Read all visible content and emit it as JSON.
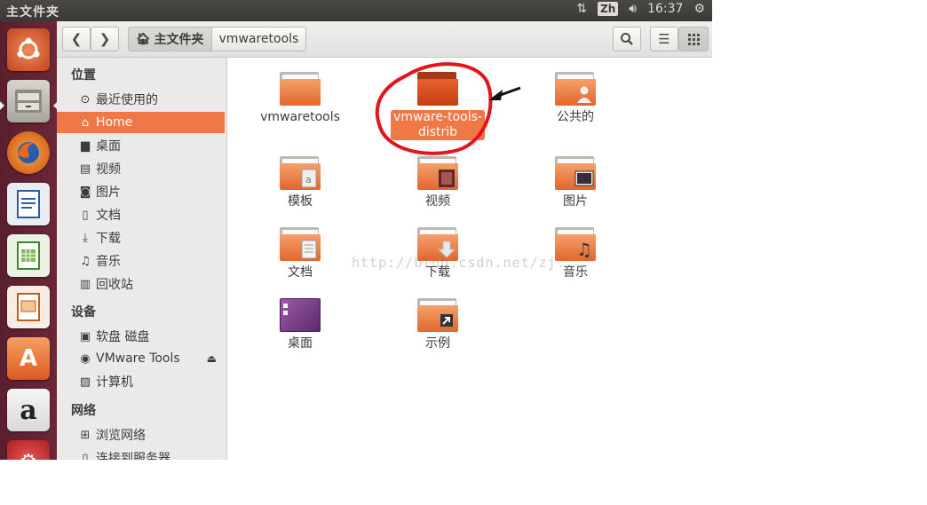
{
  "topbar": {
    "title": "主文件夹",
    "input_method": "Zh",
    "time": "16:37"
  },
  "launcher": {
    "items": [
      "ubuntu-dash",
      "files",
      "firefox",
      "writer",
      "calc",
      "impress",
      "software-center",
      "amazon",
      "settings"
    ]
  },
  "toolbar": {
    "crumb_home": "主文件夹",
    "crumb_current": "vmwaretools"
  },
  "sidebar": {
    "places_header": "位置",
    "places": [
      {
        "label": "最近使用的",
        "icon": "clock-icon"
      },
      {
        "label": "Home",
        "icon": "home-icon"
      },
      {
        "label": "桌面",
        "icon": "desktop-icon"
      },
      {
        "label": "视频",
        "icon": "film-icon"
      },
      {
        "label": "图片",
        "icon": "camera-icon"
      },
      {
        "label": "文档",
        "icon": "document-icon"
      },
      {
        "label": "下载",
        "icon": "download-icon"
      },
      {
        "label": "音乐",
        "icon": "music-icon"
      },
      {
        "label": "回收站",
        "icon": "trash-icon"
      }
    ],
    "devices_header": "设备",
    "devices": [
      {
        "label": "软盘 磁盘",
        "icon": "floppy-icon"
      },
      {
        "label": "VMware Tools",
        "icon": "cdrom-icon"
      },
      {
        "label": "计算机",
        "icon": "computer-icon"
      }
    ],
    "network_header": "网络",
    "network": [
      {
        "label": "浏览网络",
        "icon": "network-icon"
      },
      {
        "label": "连接到服务器",
        "icon": "server-icon"
      }
    ]
  },
  "files": [
    {
      "name": "vmwaretools",
      "emblem": "none"
    },
    {
      "name": "vmware-tools-distrib",
      "line1": "vmware-tools-",
      "line2": "distrib",
      "emblem": "none",
      "selected": true
    },
    {
      "name": "公共的",
      "emblem": "person-icon"
    },
    {
      "name": "模板",
      "emblem": "template-icon"
    },
    {
      "name": "视频",
      "emblem": "film-icon"
    },
    {
      "name": "图片",
      "emblem": "picture-icon"
    },
    {
      "name": "文档",
      "emblem": "document-icon"
    },
    {
      "name": "下载",
      "emblem": "download-icon"
    },
    {
      "name": "音乐",
      "emblem": "music-icon"
    },
    {
      "name": "桌面",
      "emblem": "desktop-icon"
    },
    {
      "name": "示例",
      "emblem": "link-icon"
    }
  ],
  "watermark": "http://blog.csdn.net/zj..."
}
